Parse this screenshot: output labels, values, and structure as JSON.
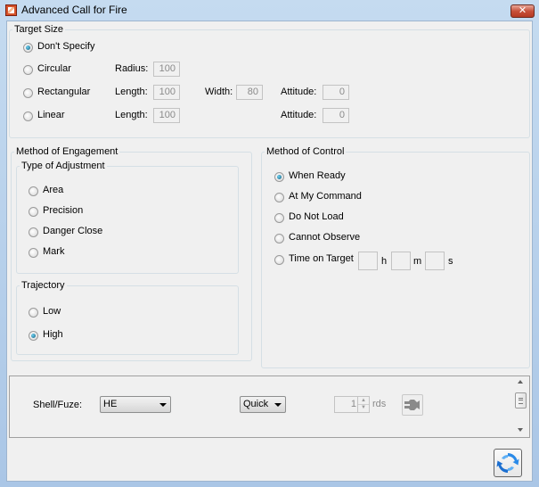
{
  "window": {
    "title": "Advanced Call for Fire",
    "close_label": "✕"
  },
  "target_size": {
    "legend": "Target Size",
    "options": [
      {
        "label": "Don't Specify",
        "selected": true
      },
      {
        "label": "Circular",
        "selected": false
      },
      {
        "label": "Rectangular",
        "selected": false
      },
      {
        "label": "Linear",
        "selected": false
      }
    ],
    "circular": {
      "radius_label": "Radius:",
      "radius_value": "100"
    },
    "rectangular": {
      "length_label": "Length:",
      "length_value": "100",
      "width_label": "Width:",
      "width_value": "80",
      "attitude_label": "Attitude:",
      "attitude_value": "0"
    },
    "linear": {
      "length_label": "Length:",
      "length_value": "100",
      "attitude_label": "Attitude:",
      "attitude_value": "0"
    }
  },
  "method_of_engagement": {
    "legend": "Method of Engagement",
    "type_of_adjustment": {
      "legend": "Type of Adjustment",
      "options": [
        {
          "label": "Area",
          "selected": false
        },
        {
          "label": "Precision",
          "selected": false
        },
        {
          "label": "Danger Close",
          "selected": false
        },
        {
          "label": "Mark",
          "selected": false
        }
      ]
    },
    "trajectory": {
      "legend": "Trajectory",
      "options": [
        {
          "label": "Low",
          "selected": false
        },
        {
          "label": "High",
          "selected": true
        }
      ]
    }
  },
  "method_of_control": {
    "legend": "Method of Control",
    "options": [
      {
        "label": "When Ready",
        "selected": true
      },
      {
        "label": "At My Command",
        "selected": false
      },
      {
        "label": "Do Not Load",
        "selected": false
      },
      {
        "label": "Cannot Observe",
        "selected": false
      },
      {
        "label": "Time on Target",
        "selected": false
      }
    ],
    "time_on_target": {
      "hours": "",
      "hours_unit": "h",
      "minutes": "",
      "minutes_unit": "m",
      "seconds": "",
      "seconds_unit": "s"
    }
  },
  "munitions": {
    "shell_fuze_label": "Shell/Fuze:",
    "shell_value": "HE",
    "fuze_value": "Quick",
    "rounds_value": "1",
    "rounds_unit": "rds",
    "icons": {
      "connect": "plug-icon",
      "refresh": "refresh-icon"
    }
  },
  "colors": {
    "accent_radio": "#11607f",
    "title_close": "#c7503a",
    "refresh_blue": "#2a8ae8"
  }
}
